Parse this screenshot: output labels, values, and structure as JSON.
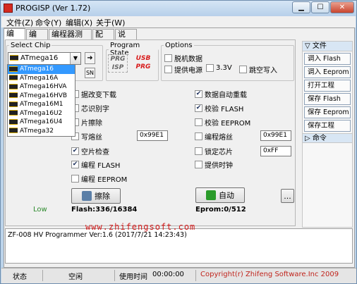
{
  "window": {
    "title": "PROGISP (Ver 1.72)",
    "minimize": "▁",
    "maximize": "☐",
    "close": "✕"
  },
  "menu": [
    "文件(Z)",
    "命令(Y)",
    "编辑(X)",
    "关于(W)"
  ],
  "tabs": [
    "编 程",
    "编 辑",
    "编程器测试",
    "配 置",
    "说 明"
  ],
  "select_chip": {
    "legend": "Select Chip",
    "selected": "ATmega16",
    "sn_label": "SN",
    "options": [
      "ATmega16",
      "ATmega16A",
      "ATmega16HVA",
      "ATmega16HVB",
      "ATmega16M1",
      "ATmega16U2",
      "ATmega16U4",
      "ATmega32"
    ]
  },
  "program_state": {
    "legend": "Program State",
    "prg_isp": "PRG ISP",
    "usb_prg": "USB PRG"
  },
  "options": {
    "legend": "Options",
    "items": [
      {
        "label": "脱机数据",
        "checked": false
      },
      {
        "label": "提供电源",
        "checked": false
      },
      {
        "label": "3.3V",
        "checked": false
      },
      {
        "label": "跳空写入",
        "checked": false
      }
    ]
  },
  "checks_left": [
    {
      "label": "据改变下载",
      "checked": false
    },
    {
      "label": "芯识别字",
      "checked": false
    },
    {
      "label": "片擦除",
      "checked": false
    },
    {
      "label": "写熔丝",
      "checked": false,
      "value": "0x99E1"
    },
    {
      "label": "空片检查",
      "checked": true
    },
    {
      "label": "编程 FLASH",
      "checked": true
    },
    {
      "label": "编程 EEPROM",
      "checked": false
    }
  ],
  "checks_right": [
    {
      "label": "数据自动重载",
      "checked": true
    },
    {
      "label": "校验 FLASH",
      "checked": true
    },
    {
      "label": "校验 EEPROM",
      "checked": false
    },
    {
      "label": "编程熔丝",
      "checked": false,
      "value": "0x99E1"
    },
    {
      "label": "锁定芯片",
      "checked": false,
      "value": "0xFF"
    },
    {
      "label": "提供时钟",
      "checked": false
    }
  ],
  "buttons": {
    "erase": "擦除",
    "auto": "自动",
    "more": "..."
  },
  "low_label": "Low",
  "flash_info": "Flash:336/16384",
  "eprom_info": "Eprom:0/512",
  "right_panel": {
    "file_header": "文件",
    "buttons": [
      "调入 Flash",
      "调入 Eeprom",
      "打开工程",
      "保存 Flash",
      "保存 Eeprom",
      "保存工程"
    ],
    "cmd_header": "命令"
  },
  "log": "ZF-008 HV Programmer Ver:1.6 (2017/7/21 14:23:43)",
  "watermark": "www.zhifengsoft.com",
  "status": {
    "state_label": "状态",
    "state_value": "空闲",
    "time_label": "使用时间",
    "time_value": "00:00:00",
    "copyright": "Copyright(r) Zhifeng Software.Inc 2009"
  },
  "colors": {
    "accent": "#3399ff",
    "copyright": "#c0241c",
    "title_bg": "#bcd3ea"
  }
}
